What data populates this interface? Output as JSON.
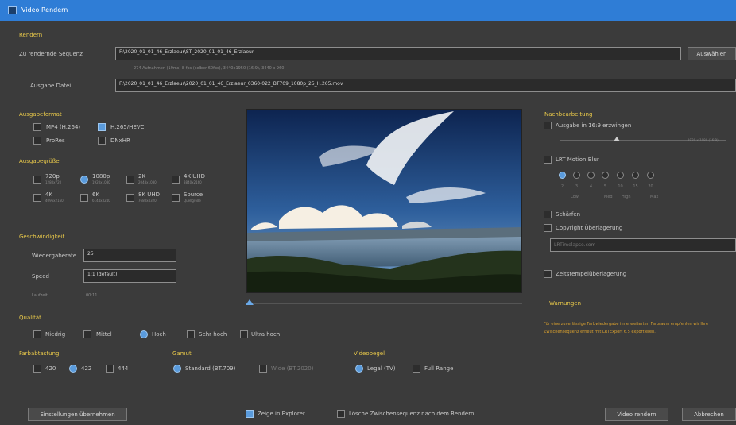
{
  "window": {
    "title": "Video Rendern"
  },
  "render": {
    "section": "Rendern",
    "sequence_label": "Zu rendernde Sequenz",
    "sequence_value": "F:\\2020_01_01_46_Erzlaeur\\ST_2020_01_01_46_Erzlaeur",
    "sequence_info": "274 Aufnahmen (19ms) 8 fps (selber 60fps), 3440x1950 (16:9), 3440 x 960",
    "select_button": "Auswählen",
    "output_label": "Ausgabe Datei",
    "output_value": "F:\\2020_01_01_46_Erzlaeur\\2020_01_01_46_Erzlaeur_0360-022_BT709_1080p_25_H.265.mov"
  },
  "format": {
    "section": "Ausgabeformat",
    "options": [
      {
        "label": "MP4 (H.264)",
        "checked": false
      },
      {
        "label": "H.265/HEVC",
        "checked": true
      },
      {
        "label": "ProRes",
        "checked": false
      },
      {
        "label": "DNxHR",
        "checked": false
      }
    ]
  },
  "size": {
    "section": "Ausgabegröße",
    "options": [
      {
        "label": "720p",
        "sub": "1280x720",
        "checked": false
      },
      {
        "label": "1080p",
        "sub": "1920x1080",
        "checked": true
      },
      {
        "label": "2K",
        "sub": "2048x1080",
        "checked": false
      },
      {
        "label": "4K UHD",
        "sub": "3840x2160",
        "checked": false
      },
      {
        "label": "4K",
        "sub": "4096x2160",
        "checked": false
      },
      {
        "label": "6K",
        "sub": "6144x3240",
        "checked": false
      },
      {
        "label": "8K UHD",
        "sub": "7680x4320",
        "checked": false
      },
      {
        "label": "Source",
        "sub": "Quellgröße",
        "checked": false
      }
    ]
  },
  "speed": {
    "section": "Geschwindigkeit",
    "fps_label": "Wiedergaberate",
    "fps_value": "25",
    "speed_label": "Speed",
    "speed_value": "1:1 (default)",
    "duration_label": "Laufzeit",
    "duration_value": "00:11"
  },
  "quality": {
    "section": "Qualität",
    "options": [
      {
        "label": "Niedrig",
        "checked": false
      },
      {
        "label": "Mittel",
        "checked": false
      },
      {
        "label": "Hoch",
        "checked": true
      },
      {
        "label": "Sehr hoch",
        "checked": false
      },
      {
        "label": "Ultra hoch",
        "checked": false
      }
    ]
  },
  "chroma": {
    "section": "Farbabtastung",
    "options": [
      {
        "label": "420",
        "checked": false
      },
      {
        "label": "422",
        "checked": true
      },
      {
        "label": "444",
        "checked": false
      }
    ]
  },
  "gamut": {
    "section": "Gamut",
    "options": [
      {
        "label": "Standard (BT.709)",
        "checked": true
      },
      {
        "label": "Wide (BT.2020)",
        "checked": false
      }
    ]
  },
  "levels": {
    "section": "Videopegel",
    "options": [
      {
        "label": "Legal (TV)",
        "checked": true
      },
      {
        "label": "Full Range",
        "checked": false
      }
    ]
  },
  "post": {
    "section": "Nachbearbeitung",
    "crop_16_9": "Ausgabe in 16:9 erzwingen",
    "crop_info": "1920 x 1080 (16:9)",
    "motion_blur": "LRT Motion Blur",
    "blur_steps": [
      "2",
      "3",
      "4",
      "5",
      "10",
      "15",
      "20"
    ],
    "blur_scale": [
      "Low",
      "Med",
      "High",
      "Max"
    ],
    "sharpen": "Schärfen",
    "copyright": "Copyright Überlagerung",
    "copyright_placeholder": "LRTimelapse.com",
    "timestamp": "Zeitstempelüberlagerung"
  },
  "warnings": {
    "section": "Warnungen",
    "text": "Für eine zuverlässige Farbwiedergabe im erweiterten Farbraum empfehlen wir Ihre Zwischensequenz erneut mit LRTExport 6.5 exportieren."
  },
  "footer": {
    "apply_settings": "Einstellungen übernehmen",
    "show_explorer": "Zeige in Explorer",
    "delete_intermediate": "Lösche Zwischensequenz nach dem Rendern",
    "render_button": "Video rendern",
    "cancel_button": "Abbrechen"
  },
  "colors": {
    "accent": "#2f7dd6",
    "section_title": "#e8c84a",
    "warning_text": "#d9a02e"
  }
}
